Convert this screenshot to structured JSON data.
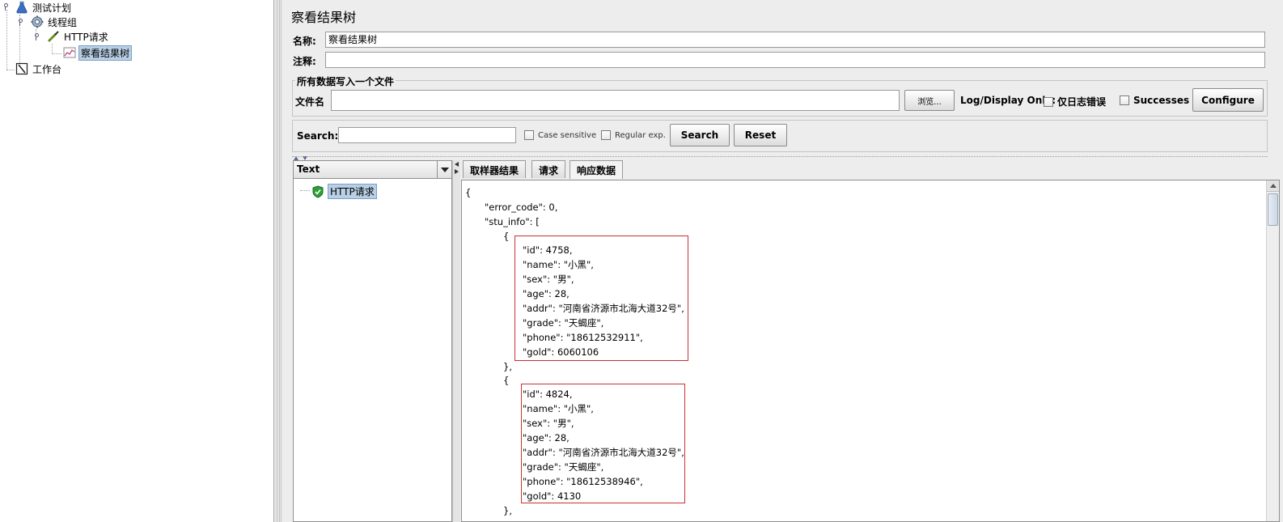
{
  "tree": {
    "items": [
      {
        "label": "测试计划",
        "icon": "flask-icon"
      },
      {
        "label": "线程组",
        "icon": "gear-icon"
      },
      {
        "label": "HTTP请求",
        "icon": "pipette-icon"
      },
      {
        "label": "察看结果树",
        "icon": "chart-icon"
      },
      {
        "label": "工作台",
        "icon": "workbench-icon"
      }
    ]
  },
  "panel": {
    "title": "察看结果树",
    "name_label": "名称:",
    "name_value": "察看结果树",
    "comment_label": "注释:",
    "comment_value": "",
    "file_group_title": "所有数据写入一个文件",
    "file_label": "文件名",
    "file_value": "",
    "browse_label": "浏览...",
    "log_display_label": "Log/Display Only:",
    "errors_only_label": "仅日志错误",
    "successes_label": "Successes",
    "configure_label": "Configure",
    "search_label": "Search:",
    "search_value": "",
    "case_sensitive_label": "Case sensitive",
    "regex_label": "Regular exp.",
    "search_button": "Search",
    "reset_button": "Reset"
  },
  "results": {
    "renderer": "Text",
    "samples": [
      {
        "label": "HTTP请求",
        "status": "success"
      }
    ],
    "tabs": [
      "取样器结果",
      "请求",
      "响应数据"
    ],
    "active_tab": "响应数据",
    "response_lines": [
      "{",
      "\"error_code\": 0,",
      "\"stu_info\": [",
      "{",
      "\"id\": 4758,",
      "\"name\": \"小黑\",",
      "\"sex\": \"男\",",
      "\"age\": 28,",
      "\"addr\": \"河南省济源市北海大道32号\",",
      "\"grade\": \"天蝎座\",",
      "\"phone\": \"18612532911\",",
      "\"gold\": 6060106",
      "},",
      "{",
      "\"id\": 4824,",
      "\"name\": \"小黑\",",
      "\"sex\": \"男\",",
      "\"age\": 28,",
      "\"addr\": \"河南省济源市北海大道32号\",",
      "\"grade\": \"天蝎座\",",
      "\"phone\": \"18612538946\",",
      "\"gold\": 4130",
      "},"
    ]
  },
  "colors": {
    "selection": "#b8cfe5",
    "highlight_box": "#cc3030",
    "success_shield": "#2e9e3a"
  }
}
